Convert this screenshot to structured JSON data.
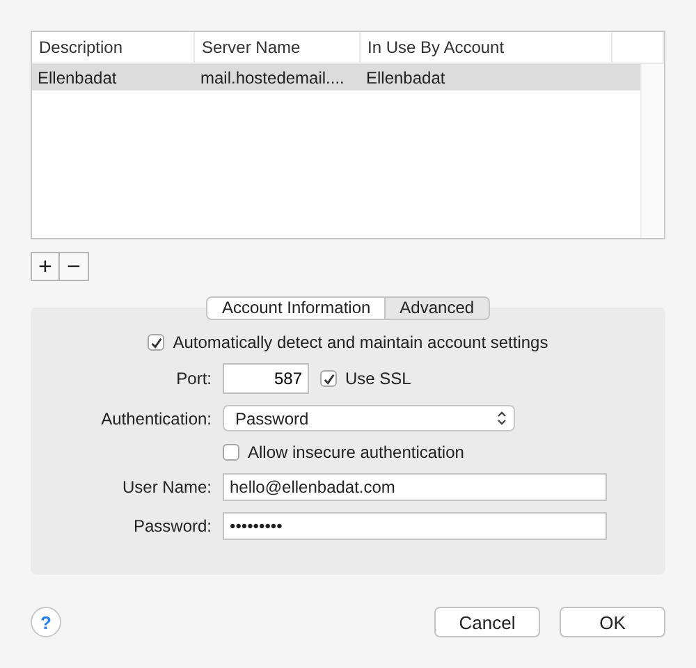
{
  "table": {
    "columns": [
      "Description",
      "Server Name",
      "In Use By Account"
    ],
    "rows": [
      {
        "cells": [
          "Ellenbadat",
          "mail.hostedemail....",
          "Ellenbadat"
        ],
        "selected": true
      }
    ]
  },
  "list_buttons": [
    "+",
    "−"
  ],
  "tabs": [
    {
      "label": "Account Information",
      "selected": true
    },
    {
      "label": "Advanced",
      "selected": false
    }
  ],
  "auto_detect": {
    "label": "Automatically detect and maintain account settings",
    "checked": true
  },
  "port": {
    "label": "Port:",
    "value": "587"
  },
  "use_ssl": {
    "label": "Use SSL",
    "checked": true
  },
  "authentication": {
    "label": "Authentication:",
    "value": "Password"
  },
  "allow_insecure": {
    "label": "Allow insecure authentication",
    "checked": false
  },
  "user_name": {
    "label": "User Name:",
    "value": "hello@ellenbadat.com"
  },
  "password": {
    "label": "Password:",
    "value": "•••••••••"
  },
  "help": "?",
  "buttons": [
    "Cancel",
    "OK"
  ]
}
